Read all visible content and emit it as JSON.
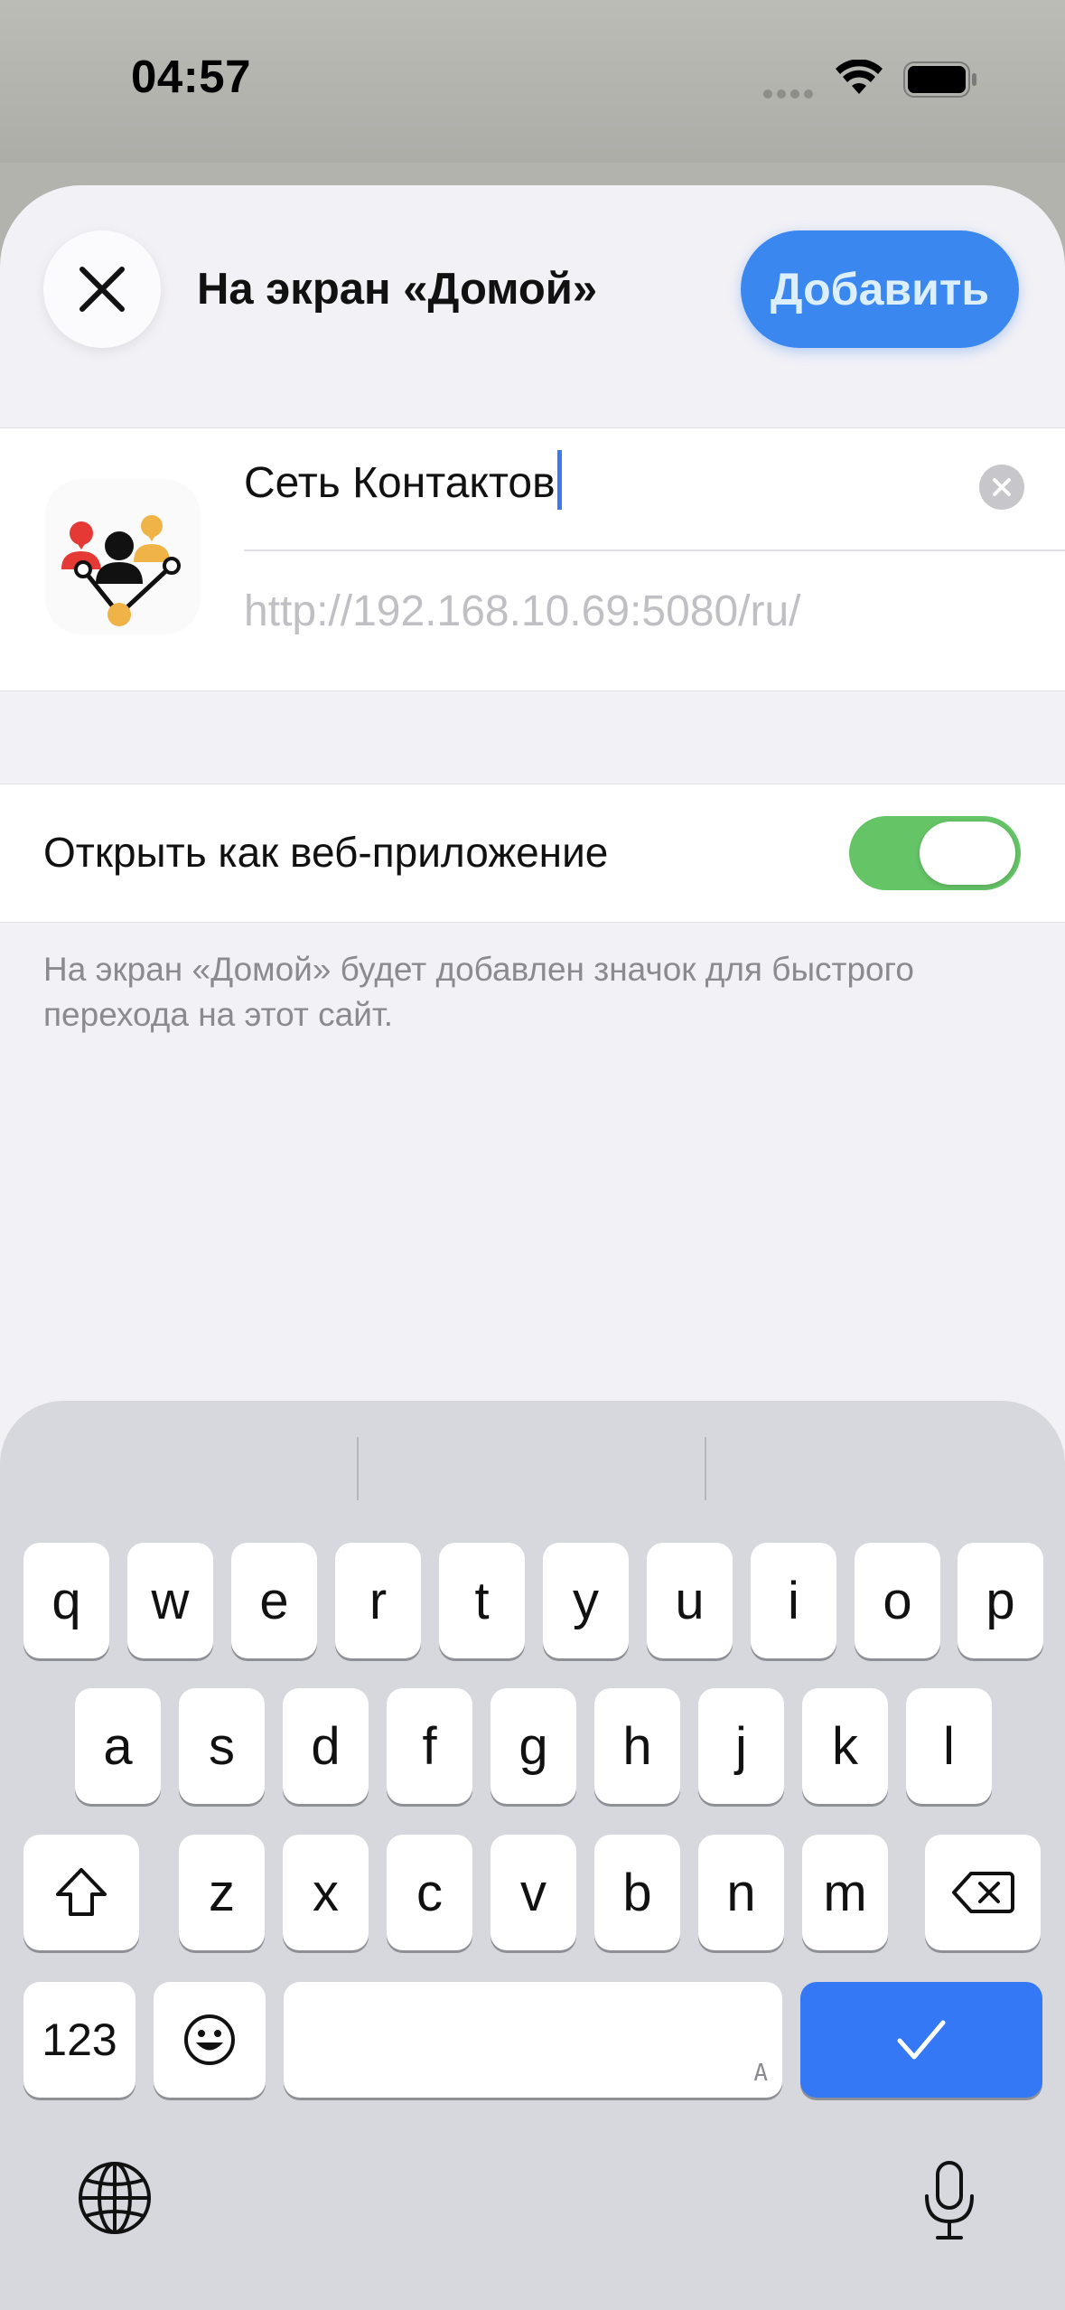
{
  "status_bar": {
    "time": "04:57"
  },
  "sheet": {
    "title": "На экран «Домой»",
    "add_label": "Добавить",
    "name_value": "Сеть Контактов",
    "url_value": "http://192.168.10.69:5080/ru/",
    "toggle_label": "Открыть как веб-приложение",
    "toggle_on": true,
    "footnote": "На экран «Домой» будет добавлен значок для быстрого перехода на этот сайт."
  },
  "keyboard": {
    "row1": [
      "q",
      "w",
      "e",
      "r",
      "t",
      "y",
      "u",
      "i",
      "o",
      "p"
    ],
    "row2": [
      "a",
      "s",
      "d",
      "f",
      "g",
      "h",
      "j",
      "k",
      "l"
    ],
    "row3": [
      "z",
      "x",
      "c",
      "v",
      "b",
      "n",
      "m"
    ],
    "numbers_label": "123",
    "space_hint": "A",
    "icons": [
      "shift-icon",
      "backspace-icon",
      "emoji-icon",
      "checkmark-icon",
      "globe-icon",
      "microphone-icon"
    ]
  },
  "colors": {
    "accent": "#3b87f0",
    "toggle_on": "#65c466",
    "done_key": "#3478f6"
  }
}
